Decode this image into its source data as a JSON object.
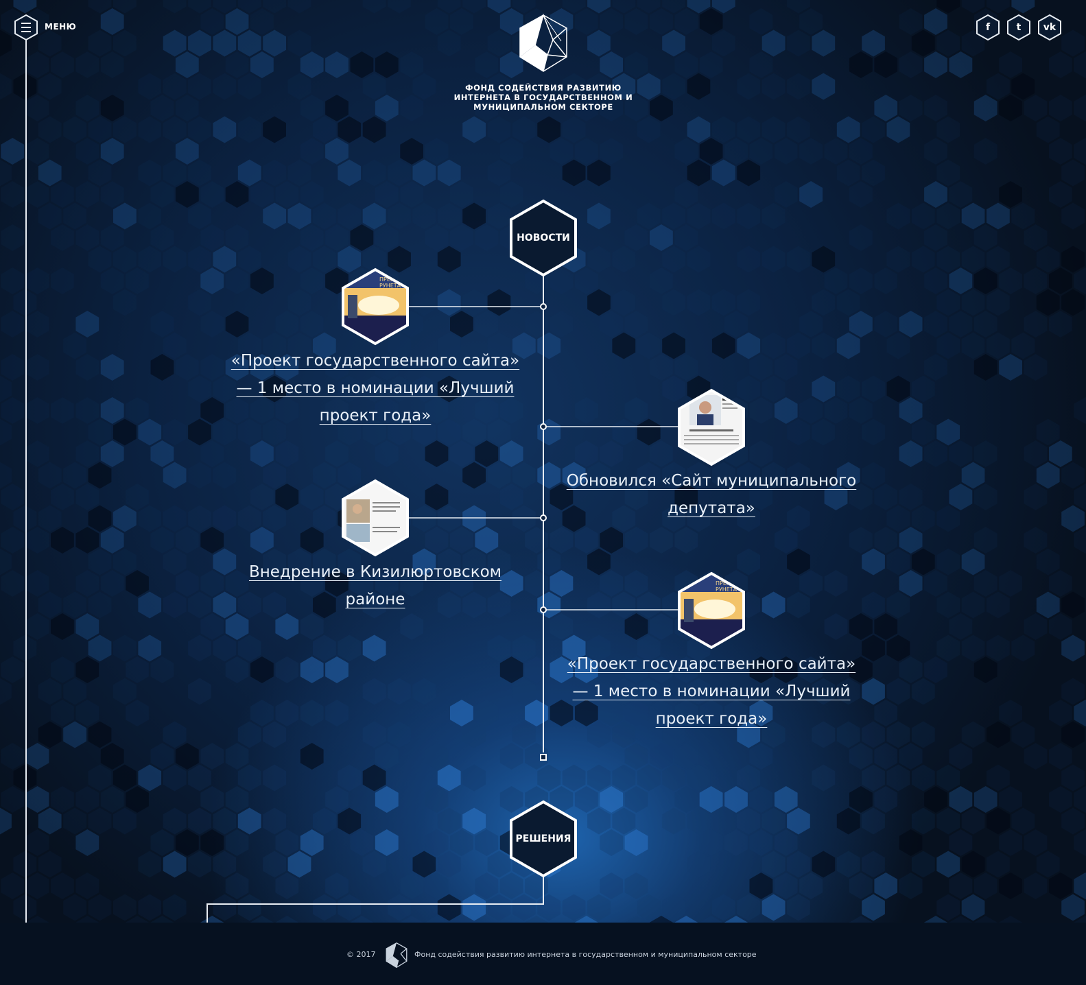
{
  "header": {
    "menu_label": "МЕНЮ",
    "org_name_lines": [
      "ФОНД СОДЕЙСТВИЯ РАЗВИТИЮ",
      "ИНТЕРНЕТА В ГОСУДАРСТВЕННОМ И",
      "МУНИЦИПАЛЬНОМ СЕКТОРЕ"
    ],
    "social": [
      {
        "icon": "facebook-icon",
        "glyph": "f"
      },
      {
        "icon": "twitter-icon",
        "glyph": "t"
      },
      {
        "icon": "vk-icon",
        "glyph": "vk"
      }
    ]
  },
  "sections": {
    "news": "НОВОСТИ",
    "solutions": "РЕШЕНИЯ"
  },
  "news": [
    {
      "title": "«Проект государственного сайта» — 1 место в номинации «Лучший проект года»",
      "thumb": "award-photo"
    },
    {
      "title": "Обновился «Сайт муниципального депутата»",
      "thumb": "deputy-site"
    },
    {
      "title": "Внедрение в Кизилюртовском районе",
      "thumb": "district-page"
    },
    {
      "title": "«Проект государственного сайта» — 1 место в номинации «Лучший проект года»",
      "thumb": "award-photo"
    }
  ],
  "footer": {
    "copyright": "© 2017",
    "org_name": "Фонд содействия развитию интернета в государственном и муниципальном секторе"
  },
  "colors": {
    "line": "#e8edf3",
    "bg_dark": "#07111f",
    "accent_blue": "#1e63ad"
  }
}
